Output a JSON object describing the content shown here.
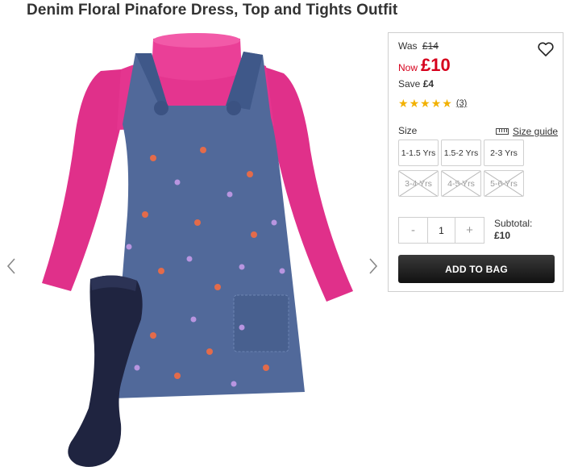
{
  "product": {
    "title": "Denim Floral Pinafore Dress, Top and Tights Outfit",
    "image_alt": "Denim floral pinafore dress with pink long-sleeve top and navy tights"
  },
  "pricing": {
    "was_label": "Was",
    "was_price": "£14",
    "now_label": "Now",
    "now_price": "£10",
    "save_label": "Save",
    "save_amount": "£4",
    "rating_stars": 5,
    "review_count": "(3)"
  },
  "size": {
    "label": "Size",
    "guide_label": "Size guide",
    "options": [
      {
        "label": "1-1.5 Yrs",
        "available": true
      },
      {
        "label": "1.5-2 Yrs",
        "available": true
      },
      {
        "label": "2-3 Yrs",
        "available": true
      },
      {
        "label": "3-4 Yrs",
        "available": false
      },
      {
        "label": "4-5 Yrs",
        "available": false
      },
      {
        "label": "5-6 Yrs",
        "available": false
      }
    ]
  },
  "quantity": {
    "minus": "-",
    "value": "1",
    "plus": "+"
  },
  "subtotal": {
    "label": "Subtotal:",
    "value": "£10"
  },
  "cta": {
    "add_to_bag": "ADD TO BAG"
  },
  "colors": {
    "price_red": "#d6001c",
    "star_gold": "#f2b100",
    "button_dark": "#1a1a1a",
    "top_pink": "#e0308a",
    "denim_blue": "#4f6a9c",
    "tights_navy": "#1f2440"
  },
  "icons": {
    "prev": "chevron-left-icon",
    "next": "chevron-right-icon",
    "wishlist": "heart-icon",
    "size_guide": "ruler-icon",
    "rating": "star-icon"
  }
}
